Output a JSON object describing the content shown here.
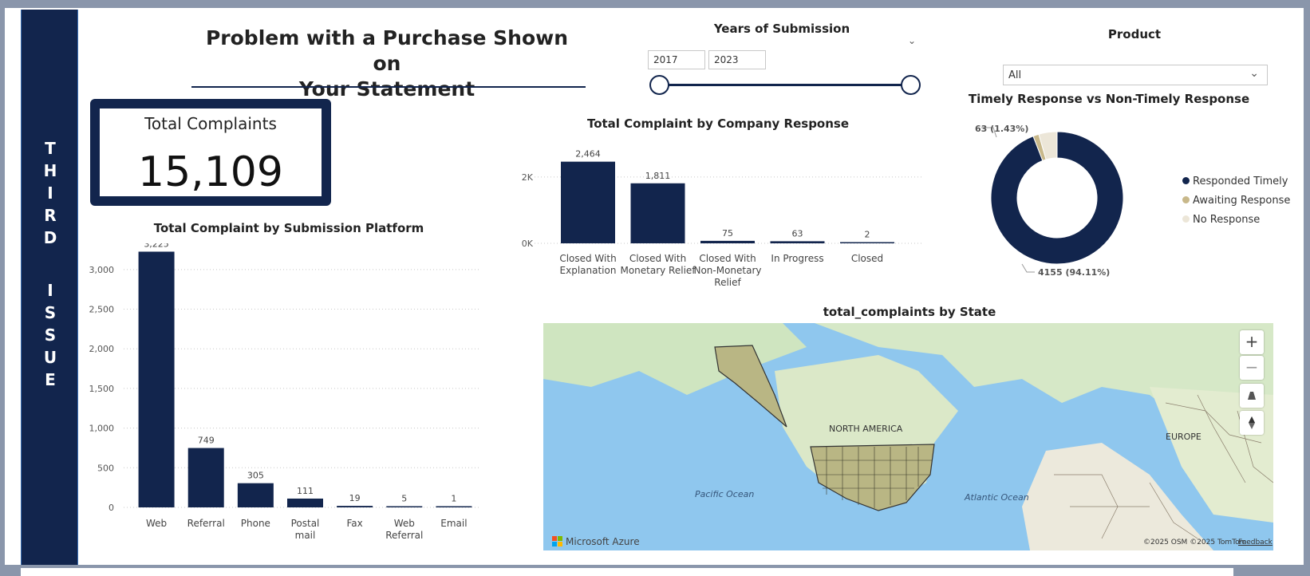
{
  "side_label": {
    "line1": [
      "T",
      "H",
      "I",
      "R",
      "D"
    ],
    "line2": [
      "I",
      "S",
      "S",
      "U",
      "E"
    ]
  },
  "page_title": "Problem with a Purchase Shown on Your Statement",
  "kpi": {
    "label": "Total Complaints",
    "value": "15,109"
  },
  "years_slicer": {
    "title": "Years of Submission",
    "from": "2017",
    "to": "2023"
  },
  "product_slicer": {
    "title": "Product",
    "selected": "All"
  },
  "platform_chart": {
    "title": "Total Complaint by Submission Platform",
    "y_ticks": [
      "0",
      "500",
      "1,000",
      "1,500",
      "2,000",
      "2,500",
      "3,000"
    ],
    "labels": [
      "3,225",
      "749",
      "305",
      "111",
      "19",
      "5",
      "1"
    ],
    "categories": [
      [
        "Web"
      ],
      [
        "Referral"
      ],
      [
        "Phone"
      ],
      [
        "Postal",
        "mail"
      ],
      [
        "Fax"
      ],
      [
        "Web",
        "Referral"
      ],
      [
        "Email"
      ]
    ]
  },
  "response_chart": {
    "title": "Total Complaint by Company Response",
    "y_ticks": [
      "0K",
      "2K"
    ],
    "labels": [
      "2,464",
      "1,811",
      "75",
      "63",
      "2"
    ],
    "categories": [
      [
        "Closed With",
        "Explanation"
      ],
      [
        "Closed With",
        "Monetary Relief"
      ],
      [
        "Closed With",
        "Non-Monetary",
        "Relief"
      ],
      [
        "In Progress"
      ],
      [
        "Closed"
      ]
    ]
  },
  "donut_chart": {
    "title": "Timely Response vs Non-Timely Response",
    "small_label": "63 (1.43%)",
    "big_label": "4155 (94.11%)",
    "legend": [
      {
        "label": "Responded Timely",
        "color": "#12254d"
      },
      {
        "label": "Awaiting Response",
        "color": "#c8b88a"
      },
      {
        "label": "No Response",
        "color": "#ece6d8"
      }
    ]
  },
  "map": {
    "title": "total_complaints by State",
    "labels": {
      "north_america": "NORTH AMERICA",
      "europe": "EUROPE",
      "pacific": "Pacific Ocean",
      "atlantic": "Atlantic Ocean"
    },
    "brand": "Microsoft Azure",
    "attribution": "©2025 OSM ©2025 TomTom",
    "feedback": "Feedback",
    "zoom_in": "+",
    "zoom_out": "−"
  },
  "chart_data": [
    {
      "type": "bar",
      "title": "Total Complaint by Submission Platform",
      "categories": [
        "Web",
        "Referral",
        "Phone",
        "Postal mail",
        "Fax",
        "Web Referral",
        "Email"
      ],
      "values": [
        3225,
        749,
        305,
        111,
        19,
        5,
        1
      ],
      "xlabel": "",
      "ylabel": "",
      "ylim": [
        0,
        3300
      ],
      "grid": true
    },
    {
      "type": "bar",
      "title": "Total Complaint by Company Response",
      "categories": [
        "Closed With Explanation",
        "Closed With Monetary Relief",
        "Closed With Non-Monetary Relief",
        "In Progress",
        "Closed"
      ],
      "values": [
        2464,
        1811,
        75,
        63,
        2
      ],
      "xlabel": "",
      "ylabel": "",
      "ylim": [
        0,
        2600
      ],
      "grid": true
    },
    {
      "type": "pie",
      "title": "Timely Response vs Non-Timely Response",
      "categories": [
        "Responded Timely",
        "Awaiting Response",
        "No Response"
      ],
      "values": [
        4155,
        63,
        197
      ],
      "legend": "right"
    }
  ]
}
